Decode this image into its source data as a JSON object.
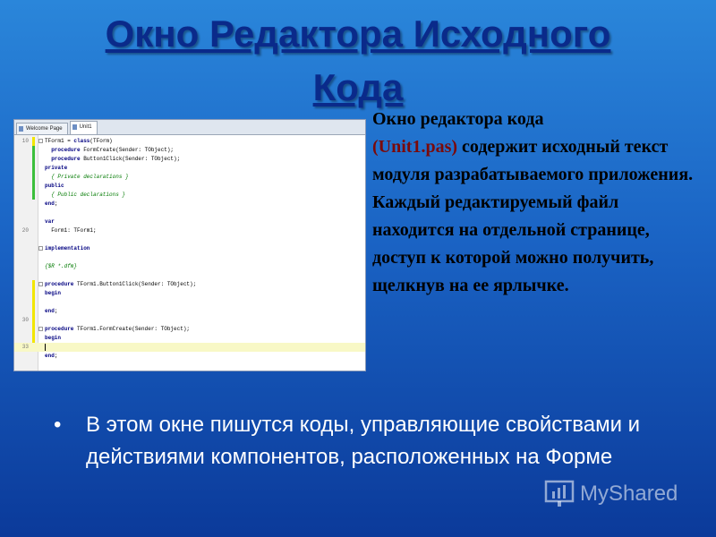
{
  "slide": {
    "title_line1": "Окно Редактора Исходного",
    "title_line2": "Кода",
    "description": {
      "part1": "Окно редактора кода",
      "highlight": "(Unit1.pas)",
      "part2": " содержит исходный текст модуля разрабатываемого приложения.  Каждый редактируемый  файл находится на отдельной странице,  доступ  к которой можно получить, щелкнув на ее ярлычке."
    },
    "bullet": "В этом окне пишутся коды, управляющие свойствами и действиями компонентов, расположенных на Форме",
    "bullet_marker": "•",
    "brand": "MyShared"
  },
  "editor": {
    "tabs": [
      "Welcome Page",
      "Unit1"
    ],
    "active_tab": "Unit1",
    "lines": [
      {
        "n": "10",
        "fold": true,
        "code": [
          {
            "t": "TForm1 = "
          },
          {
            "t": "class",
            "c": "kw"
          },
          {
            "t": "(TForm)"
          }
        ]
      },
      {
        "n": "",
        "fold": false,
        "code": [
          {
            "t": "  "
          },
          {
            "t": "procedure",
            "c": "kw"
          },
          {
            "t": " FormCreate(Sender: TObject);"
          }
        ]
      },
      {
        "n": "",
        "fold": false,
        "code": [
          {
            "t": "  "
          },
          {
            "t": "procedure",
            "c": "kw"
          },
          {
            "t": " Button1Click(Sender: TObject);"
          }
        ]
      },
      {
        "n": "",
        "fold": false,
        "code": [
          {
            "t": "private",
            "c": "kw"
          }
        ]
      },
      {
        "n": "",
        "fold": false,
        "code": [
          {
            "t": "  { Private declarations }",
            "c": "cm"
          }
        ]
      },
      {
        "n": "",
        "fold": false,
        "code": [
          {
            "t": "public",
            "c": "kw"
          }
        ]
      },
      {
        "n": "",
        "fold": false,
        "code": [
          {
            "t": "  { Public declarations }",
            "c": "cm"
          }
        ]
      },
      {
        "n": "",
        "fold": false,
        "code": [
          {
            "t": "end",
            "c": "kw"
          },
          {
            "t": ";"
          }
        ]
      },
      {
        "n": "",
        "fold": false,
        "code": []
      },
      {
        "n": "",
        "fold": false,
        "code": [
          {
            "t": "var",
            "c": "kw"
          }
        ]
      },
      {
        "n": "20",
        "fold": false,
        "code": [
          {
            "t": "  Form1: TForm1;"
          }
        ]
      },
      {
        "n": "",
        "fold": false,
        "code": []
      },
      {
        "n": "",
        "fold": true,
        "code": [
          {
            "t": "implementation",
            "c": "kw"
          }
        ]
      },
      {
        "n": "",
        "fold": false,
        "code": []
      },
      {
        "n": "",
        "fold": false,
        "code": [
          {
            "t": "{$R *.dfm}",
            "c": "cm"
          }
        ]
      },
      {
        "n": "",
        "fold": false,
        "code": []
      },
      {
        "n": "",
        "fold": true,
        "code": [
          {
            "t": "procedure",
            "c": "kw"
          },
          {
            "t": " TForm1.Button1Click(Sender: TObject);"
          }
        ]
      },
      {
        "n": "",
        "fold": false,
        "code": [
          {
            "t": "begin",
            "c": "kw"
          }
        ]
      },
      {
        "n": "",
        "fold": false,
        "code": []
      },
      {
        "n": "",
        "fold": false,
        "code": [
          {
            "t": "end",
            "c": "kw"
          },
          {
            "t": ";"
          }
        ]
      },
      {
        "n": "30",
        "fold": false,
        "code": []
      },
      {
        "n": "",
        "fold": true,
        "code": [
          {
            "t": "procedure",
            "c": "kw"
          },
          {
            "t": " TForm1.FormCreate(Sender: TObject);"
          }
        ]
      },
      {
        "n": "",
        "fold": false,
        "code": [
          {
            "t": "begin",
            "c": "kw"
          }
        ]
      },
      {
        "n": "33",
        "fold": false,
        "code": [],
        "cursor": true
      },
      {
        "n": "",
        "fold": false,
        "code": [
          {
            "t": "end",
            "c": "kw"
          },
          {
            "t": ";"
          }
        ]
      },
      {
        "n": "",
        "fold": false,
        "code": []
      },
      {
        "n": "",
        "fold": true,
        "code": [
          {
            "t": "end",
            "c": "kw"
          },
          {
            "t": "."
          }
        ]
      }
    ]
  },
  "colors": {
    "modified_bar": "#f2e600",
    "saved_bar": "#3bbf3b"
  }
}
